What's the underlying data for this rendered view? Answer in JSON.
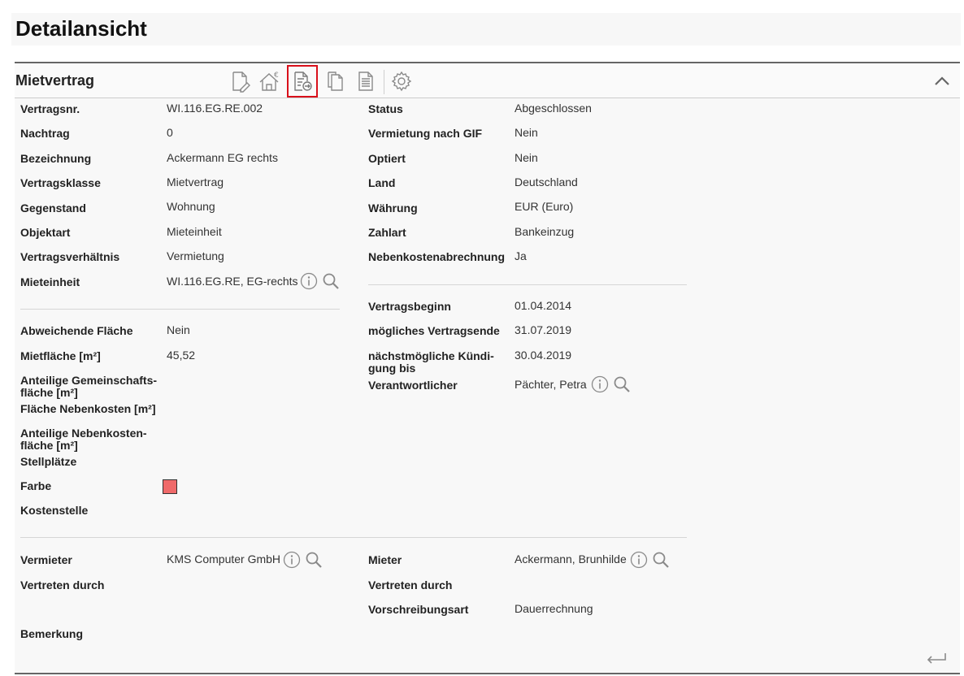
{
  "header": {
    "title": "Detailansicht"
  },
  "section": {
    "title": "Mietvertrag"
  },
  "colors": {
    "farbe": "#f06a6a",
    "highlight": "#d9101b"
  },
  "left": {
    "vertragsnr": {
      "label": "Vertragsnr.",
      "value": "WI.116.EG.RE.002"
    },
    "nachtrag": {
      "label": "Nachtrag",
      "value": "0"
    },
    "bezeichnung": {
      "label": "Bezeichnung",
      "value": "Ackermann EG rechts"
    },
    "vertragsklasse": {
      "label": "Vertragsklasse",
      "value": "Mietvertrag"
    },
    "gegenstand": {
      "label": "Gegenstand",
      "value": "Wohnung"
    },
    "objektart": {
      "label": "Objektart",
      "value": "Mieteinheit"
    },
    "vertragsverhaeltnis": {
      "label": "Vertragsverhältnis",
      "value": "Vermietung"
    },
    "mieteinheit": {
      "label": "Mieteinheit",
      "value": "WI.116.EG.RE, EG-rechts"
    },
    "abweichende_flaeche": {
      "label": "Abweichende Fläche",
      "value": "Nein"
    },
    "mietflaeche": {
      "label": "Mietfläche [m²]",
      "value": "45,52"
    },
    "gemeinschaftsflaeche": {
      "label1": "Anteilige Gemeinschafts-",
      "label2": "fläche [m²]"
    },
    "flaeche_nk": {
      "label": "Fläche Nebenkosten [m²]"
    },
    "nebenkostenflaeche": {
      "label1": "Anteilige Nebenkosten-",
      "label2": "fläche [m²]"
    },
    "stellplaetze": {
      "label": "Stellplätze"
    },
    "farbe": {
      "label": "Farbe"
    },
    "kostenstelle": {
      "label": "Kostenstelle"
    }
  },
  "right": {
    "status": {
      "label": "Status",
      "value": "Abgeschlossen"
    },
    "vermietung_gif": {
      "label": "Vermietung nach GIF",
      "value": "Nein"
    },
    "optiert": {
      "label": "Optiert",
      "value": "Nein"
    },
    "land": {
      "label": "Land",
      "value": "Deutschland"
    },
    "waehrung": {
      "label": "Währung",
      "value": "EUR (Euro)"
    },
    "zahlart": {
      "label": "Zahlart",
      "value": "Bankeinzug"
    },
    "nk_abrechnung": {
      "label": "Nebenkostenabrechnung",
      "value": "Ja"
    },
    "vertragsbeginn": {
      "label": "Vertragsbeginn",
      "value": "01.04.2014"
    },
    "vertragsende": {
      "label": "mögliches Vertragsende",
      "value": "31.07.2019"
    },
    "kuendigung": {
      "label1": "nächstmögliche Kündi-",
      "label2": "gung bis",
      "value": "30.04.2019"
    },
    "verantwortlicher": {
      "label": "Verantwortlicher",
      "value": "Pächter, Petra"
    }
  },
  "parties": {
    "vermieter": {
      "label": "Vermieter",
      "value": "KMS Computer GmbH"
    },
    "vertreten_left": {
      "label": "Vertreten durch"
    },
    "bemerkung": {
      "label": "Bemerkung"
    },
    "mieter": {
      "label": "Mieter",
      "value": "Ackermann, Brunhilde"
    },
    "vertreten_right": {
      "label": "Vertreten durch"
    },
    "vorschreibungsart": {
      "label": "Vorschreibungsart",
      "value": "Dauerrechnung"
    }
  }
}
